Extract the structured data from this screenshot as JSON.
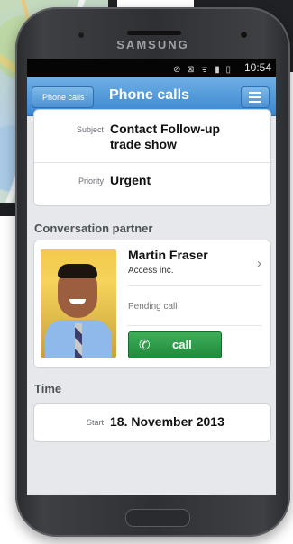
{
  "device": {
    "brand": "SAMSUNG"
  },
  "status_bar": {
    "icons": "⊘ ⊠ ᯤ ▮ ▯",
    "time": "10:54"
  },
  "nav": {
    "back_label": "Phone calls",
    "title": "Phone calls"
  },
  "details": [
    {
      "label": "Subject",
      "value": "Contact Follow-up trade show"
    },
    {
      "label": "Priority",
      "value": "Urgent"
    }
  ],
  "partner_section": {
    "title": "Conversation partner",
    "name": "Martin Fraser",
    "company": "Access inc.",
    "status": "Pending call",
    "call_label": "call"
  },
  "time_section": {
    "title": "Time",
    "start_label": "Start",
    "start_value": "18. November 2013"
  },
  "colors": {
    "nav_blue": "#3a86cf",
    "call_green": "#1f8a3b"
  }
}
